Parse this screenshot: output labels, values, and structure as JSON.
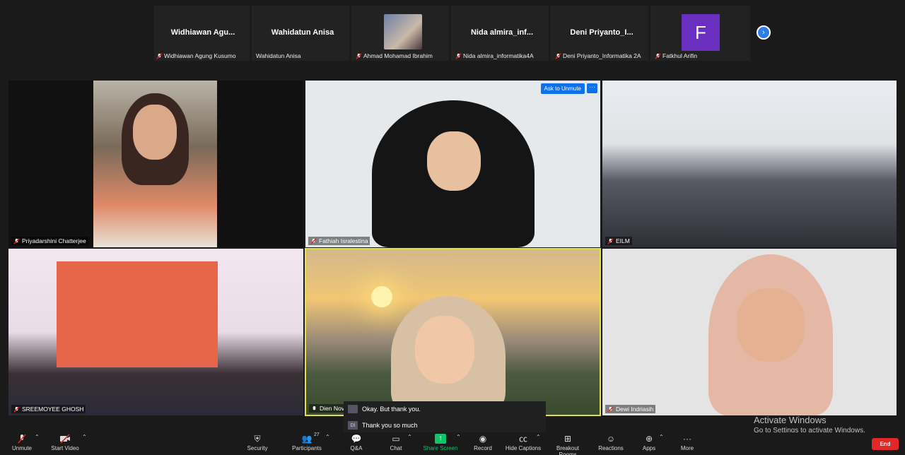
{
  "strip": {
    "thumbs": [
      {
        "name": "Widhiawan Agu...",
        "caption": "Widhiawan Agung Kusumo"
      },
      {
        "name": "Wahidatun Anisa",
        "caption": "Wahidatun Anisa"
      },
      {
        "name": "",
        "caption": "Ahmad Mohamad Ibrahim"
      },
      {
        "name": "Nida  almira_inf...",
        "caption": "Nida almira_informatika4A"
      },
      {
        "name": "Deni  Priyanto_I...",
        "caption": "Deni Priyanto_Informatika 2A"
      },
      {
        "name": "",
        "caption": "Fatkhul Arifin"
      }
    ],
    "avatar_letter": "F",
    "next_icon": "›"
  },
  "tiles": {
    "t1": "Priyadarshini Chatterjee",
    "t2": "Fathiah Isralestina",
    "t3": "EILM",
    "t4": "SREEMOYEE GHOSH",
    "t5": "Dien Novi...",
    "t6": "Dewi Indriasih"
  },
  "ask_to_unmute": "Ask to Unmute",
  "more_dots": "···",
  "chat": {
    "msg1": "Okay. But thank you.",
    "msg2": "Thank you so much",
    "initials": "DI"
  },
  "activate": {
    "title": "Activate Windows",
    "subtitle": "Go to Settings to activate Windows."
  },
  "toolbar": {
    "unmute": "Unmute",
    "start_video": "Start Video",
    "security": "Security",
    "participants": "Participants",
    "participants_count": "27",
    "qa": "Q&A",
    "chat": "Chat",
    "share_screen": "Share Screen",
    "record": "Record",
    "hide_captions": "Hide Captions",
    "breakout_rooms": "Breakout Rooms",
    "reactions": "Reactions",
    "apps": "Apps",
    "more": "More",
    "end": "End"
  },
  "colors": {
    "accent_blue": "#0e71eb",
    "active_speaker": "#e4e04a",
    "end_red": "#e02828",
    "share_green": "#13c26b",
    "avatar_purple": "#6b2fbf"
  }
}
